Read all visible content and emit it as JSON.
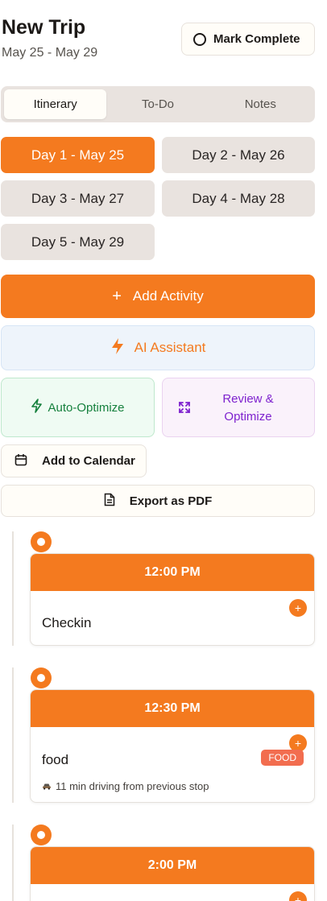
{
  "header": {
    "title": "New Trip",
    "dates": "May 25 - May 29",
    "mark_complete_label": "Mark Complete"
  },
  "tabs": [
    {
      "label": "Itinerary",
      "active": true
    },
    {
      "label": "To-Do",
      "active": false
    },
    {
      "label": "Notes",
      "active": false
    }
  ],
  "days": [
    {
      "label": "Day 1 - May 25",
      "active": true
    },
    {
      "label": "Day 2 - May 26",
      "active": false
    },
    {
      "label": "Day 3 - May 27",
      "active": false
    },
    {
      "label": "Day 4 - May 28",
      "active": false
    },
    {
      "label": "Day 5 - May 29",
      "active": false
    }
  ],
  "actions": {
    "add_activity": "Add Activity",
    "add_activity_icon": "+",
    "ai_assistant": "AI Assistant",
    "auto_optimize": "Auto-Optimize",
    "review_optimize": "Review & Optimize",
    "add_to_calendar": "Add to Calendar",
    "export_pdf": "Export as PDF"
  },
  "activities": [
    {
      "time": "12:00 PM",
      "title": "Checkin",
      "badge": "",
      "drive_note": ""
    },
    {
      "time": "12:30 PM",
      "title": "food",
      "badge": "FOOD",
      "drive_note": "11 min driving from previous stop"
    },
    {
      "time": "2:00 PM",
      "title": "",
      "badge": "",
      "drive_note": ""
    }
  ],
  "colors": {
    "accent": "#f47a1f",
    "food_badge": "#f26d4f",
    "auto_optimize": "#15803d",
    "review_optimize": "#7e22ce"
  }
}
